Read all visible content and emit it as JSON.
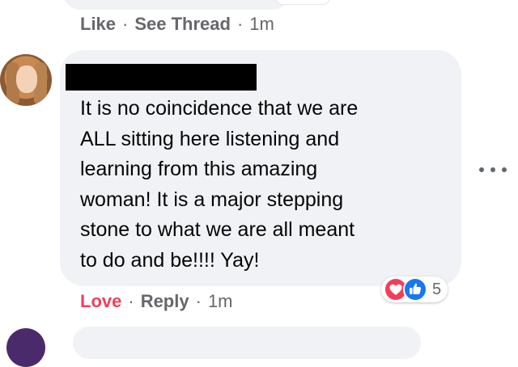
{
  "previous_comment": {
    "actions": {
      "like": "Like",
      "see_thread": "See Thread",
      "time": "1m",
      "separator": "·"
    }
  },
  "comment": {
    "author_name": "",
    "text_lines": [
      "It is no coincidence that we are",
      "ALL sitting here listening and",
      "learning from this amazing",
      "woman! It is a major stepping",
      "stone to what we are all meant",
      "to do and be!!!! Yay!"
    ],
    "actions": {
      "love": "Love",
      "reply": "Reply",
      "time": "1m",
      "separator": "·"
    },
    "reactions": {
      "icons": [
        "heart-icon",
        "like-icon"
      ],
      "count": "5"
    }
  },
  "colors": {
    "bubble": "#f0f2f5",
    "love_red": "#f33e58",
    "like_blue": "#1877f2",
    "meta_gray": "#65676b"
  }
}
